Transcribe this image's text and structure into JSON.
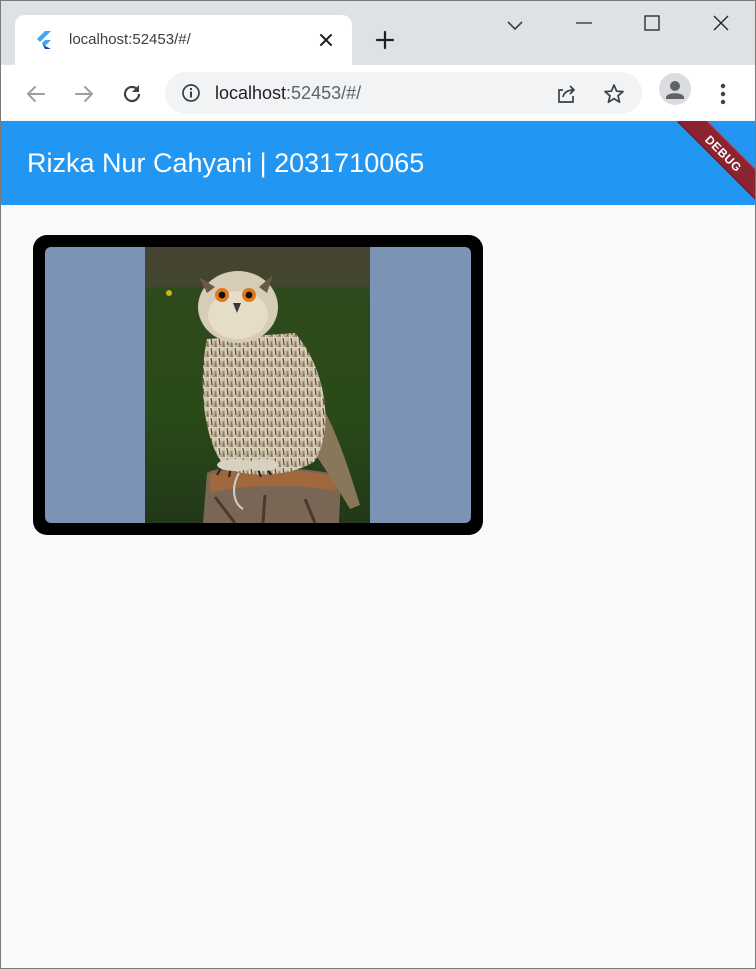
{
  "browser": {
    "tab": {
      "title": "localhost:52453/#/"
    },
    "url": {
      "host": "localhost",
      "rest": ":52453/#/"
    }
  },
  "app": {
    "title": "Rizka Nur Cahyani | 2031710065",
    "debug_label": "DEBUG"
  },
  "colors": {
    "appbar": "#2196f3",
    "card_frame": "#000000",
    "image_background": "#7b93b5",
    "debug_banner": "#8b2331"
  },
  "icons": [
    "flutter-icon",
    "close-icon",
    "plus-icon",
    "chevron-down-icon",
    "minimize-icon",
    "maximize-icon",
    "window-close-icon",
    "back-arrow-icon",
    "forward-arrow-icon",
    "reload-icon",
    "info-icon",
    "share-icon",
    "star-icon",
    "profile-icon",
    "more-vert-icon"
  ]
}
